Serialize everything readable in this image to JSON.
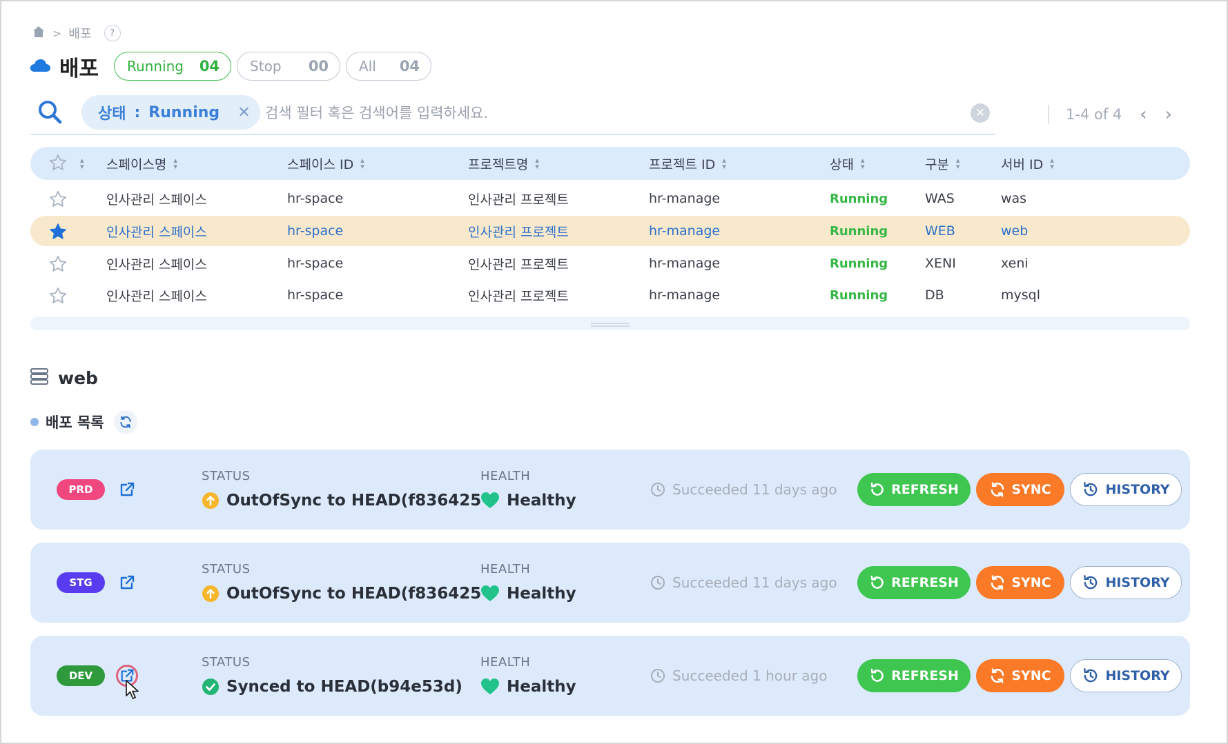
{
  "breadcrumb": {
    "home_icon": "home-icon",
    "current": "배포",
    "help": "?"
  },
  "page": {
    "title": "배포",
    "icon": "cloud-icon"
  },
  "filters": [
    {
      "label": "Running",
      "count": "04",
      "active": true
    },
    {
      "label": "Stop",
      "count": "00",
      "active": false
    },
    {
      "label": "All",
      "count": "04",
      "active": false
    }
  ],
  "search": {
    "chip_key": "상태",
    "chip_sep": ":",
    "chip_value": "Running",
    "placeholder": "검색 필터 혹은 검색어를 입력하세요."
  },
  "pagination": {
    "range": "1-4 of 4"
  },
  "table": {
    "columns": [
      "스페이스명",
      "스페이스 ID",
      "프로젝트명",
      "프로젝트 ID",
      "상태",
      "구분",
      "서버 ID"
    ],
    "rows": [
      {
        "space_name": "인사관리 스페이스",
        "space_id": "hr-space",
        "project_name": "인사관리 프로젝트",
        "project_id": "hr-manage",
        "status": "Running",
        "type": "WAS",
        "server_id": "was",
        "starred": false,
        "selected": false
      },
      {
        "space_name": "인사관리 스페이스",
        "space_id": "hr-space",
        "project_name": "인사관리 프로젝트",
        "project_id": "hr-manage",
        "status": "Running",
        "type": "WEB",
        "server_id": "web",
        "starred": true,
        "selected": true
      },
      {
        "space_name": "인사관리 스페이스",
        "space_id": "hr-space",
        "project_name": "인사관리 프로젝트",
        "project_id": "hr-manage",
        "status": "Running",
        "type": "XENI",
        "server_id": "xeni",
        "starred": false,
        "selected": false
      },
      {
        "space_name": "인사관리 스페이스",
        "space_id": "hr-space",
        "project_name": "인사관리 프로젝트",
        "project_id": "hr-manage",
        "status": "Running",
        "type": "DB",
        "server_id": "mysql",
        "starred": false,
        "selected": false
      }
    ]
  },
  "server": {
    "name": "web",
    "icon": "server-icon"
  },
  "deploy_list": {
    "title": "배포 목록"
  },
  "deployments": [
    {
      "env": "PRD",
      "env_color": "#f0477f",
      "status_label": "STATUS",
      "status": "OutOfSync to HEAD(f836425",
      "status_kind": "outofsync",
      "health_label": "HEALTH",
      "health": "Healthy",
      "time": "Succeeded 11 days ago"
    },
    {
      "env": "STG",
      "env_color": "#5a3cf0",
      "status_label": "STATUS",
      "status": "OutOfSync to HEAD(f836425",
      "status_kind": "outofsync",
      "health_label": "HEALTH",
      "health": "Healthy",
      "time": "Succeeded 11 days ago"
    },
    {
      "env": "DEV",
      "env_color": "#2e9a3c",
      "status_label": "STATUS",
      "status": "Synced to HEAD(b94e53d)",
      "status_kind": "synced",
      "health_label": "HEALTH",
      "health": "Healthy",
      "time": "Succeeded 1 hour ago"
    }
  ],
  "actions": {
    "refresh": "REFRESH",
    "sync": "SYNC",
    "history": "HISTORY"
  },
  "colors": {
    "accent": "#3b80d8",
    "running": "#35b845",
    "selected_row": "#f8e9cc",
    "card_bg": "#dceafb",
    "refresh": "#3fc650",
    "sync": "#fa7a28",
    "outofsync": "#f6b52a",
    "synced": "#22b573",
    "healthy": "#21c38a"
  }
}
